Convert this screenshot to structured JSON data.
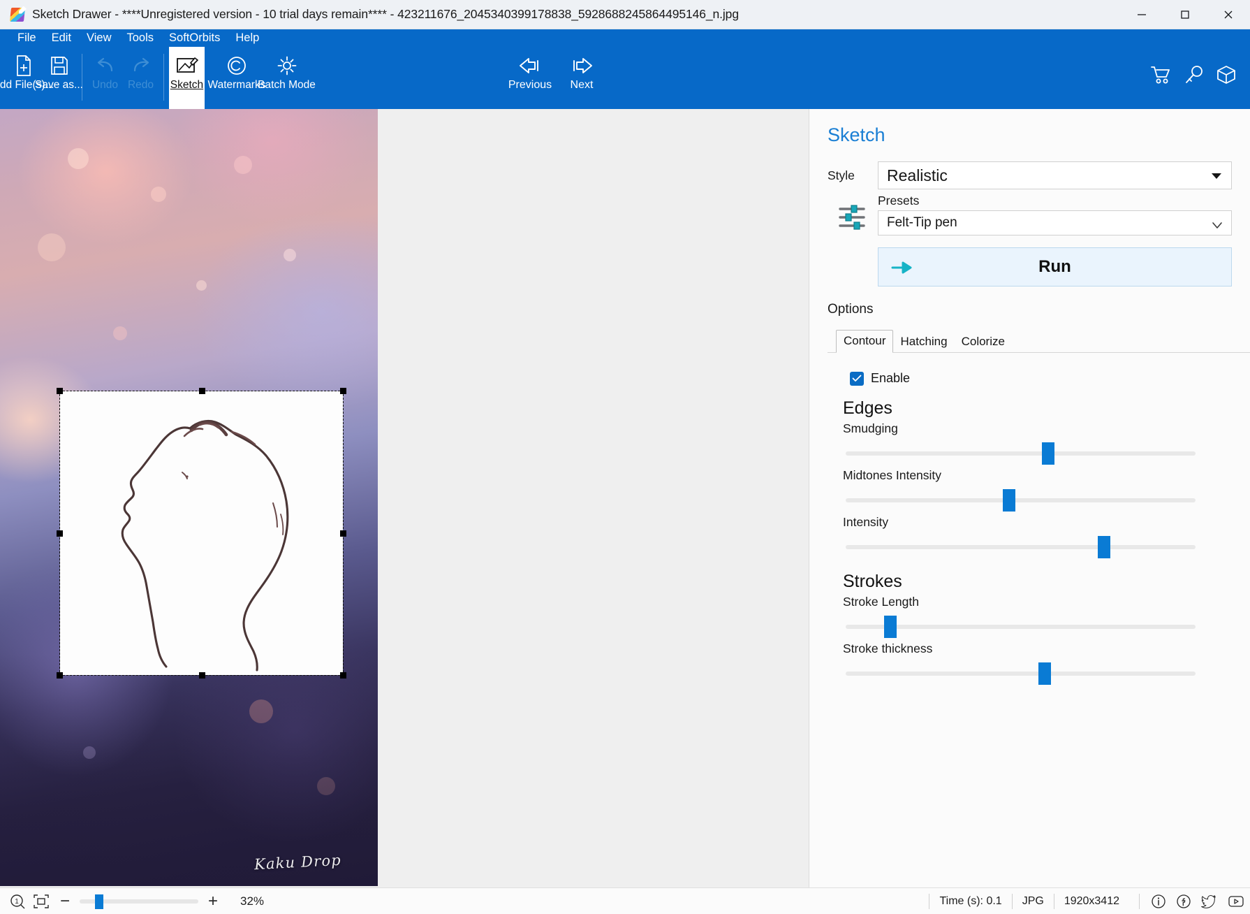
{
  "window": {
    "title": "Sketch Drawer - ****Unregistered version - 10 trial days remain**** - 423211676_2045340399178838_5928688245864495146_n.jpg",
    "minimize_label": "Minimize",
    "maximize_label": "Maximize",
    "close_label": "Close"
  },
  "menu": [
    {
      "label": "File"
    },
    {
      "label": "Edit"
    },
    {
      "label": "View"
    },
    {
      "label": "Tools"
    },
    {
      "label": "SoftOrbits"
    },
    {
      "label": "Help"
    }
  ],
  "toolbar": {
    "add_files": "Add File(s)...",
    "save_as": "Save as...",
    "undo": "Undo",
    "redo": "Redo",
    "sketch": "Sketch",
    "watermarks": "Watermarks",
    "batch_mode": "Batch Mode",
    "previous": "Previous",
    "next": "Next",
    "cart_icon": "cart-icon",
    "key_icon": "key-icon",
    "box_icon": "box-icon"
  },
  "canvas": {
    "watermark": "Kaku Drop"
  },
  "panel": {
    "title": "Sketch",
    "style_label": "Style",
    "style_value": "Realistic",
    "presets_label": "Presets",
    "presets_value": "Felt-Tip pen",
    "run_label": "Run",
    "options_label": "Options",
    "tabs": [
      {
        "label": "Contour",
        "active": true
      },
      {
        "label": "Hatching",
        "active": false
      },
      {
        "label": "Colorize",
        "active": false
      }
    ],
    "enable_label": "Enable",
    "enable_checked": true,
    "sections": [
      {
        "heading": "Edges",
        "sliders": [
          {
            "label": "Smudging",
            "value": 56
          },
          {
            "label": "Midtones Intensity",
            "value": 45
          },
          {
            "label": "Intensity",
            "value": 72
          }
        ]
      },
      {
        "heading": "Strokes",
        "sliders": [
          {
            "label": "Stroke Length",
            "value": 11
          },
          {
            "label": "Stroke thickness",
            "value": 55
          }
        ]
      }
    ]
  },
  "statusbar": {
    "actual_size_icon": "zoom-actual-size-icon",
    "fit_icon": "fit-to-window-icon",
    "zoom_out": "−",
    "zoom_in": "+",
    "zoom_value": "32%",
    "time": "Time (s): 0.1",
    "format": "JPG",
    "dimensions": "1920x3412",
    "info_icon": "info-icon",
    "facebook_icon": "facebook-icon",
    "twitter_icon": "twitter-icon",
    "youtube_icon": "youtube-icon"
  },
  "colors": {
    "ribbon": "#0769c8",
    "accent": "#1a7fd4",
    "slider": "#0a7bd4",
    "run_bg": "#eaf4fd",
    "run_arrow": "#16b3c6"
  }
}
